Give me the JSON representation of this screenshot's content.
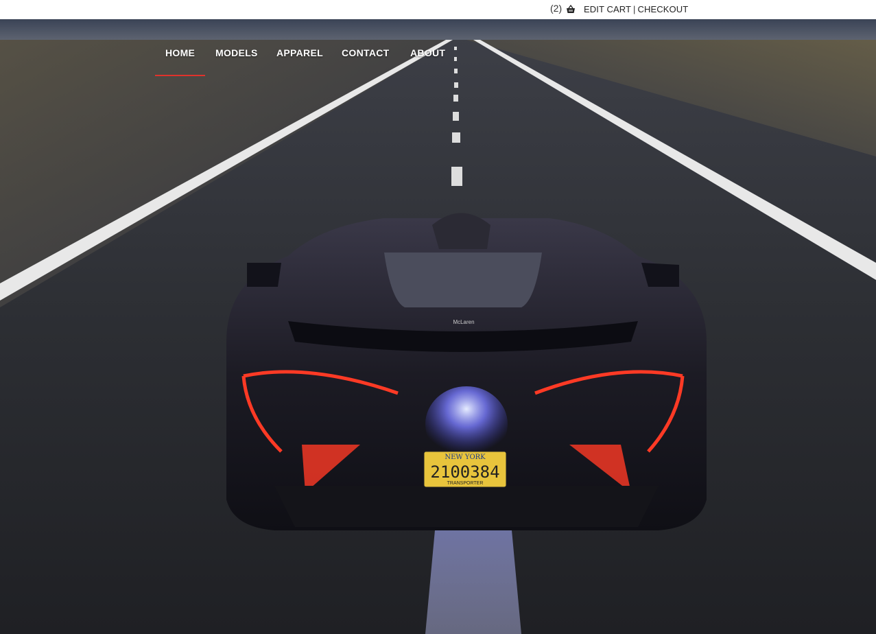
{
  "topbar": {
    "cart_count": "(2)",
    "edit_cart": "EDIT CART",
    "separator": "|",
    "checkout": "CHECKOUT"
  },
  "nav": {
    "items": [
      {
        "label": "HOME",
        "active": true
      },
      {
        "label": "MODELS"
      },
      {
        "label": "APPAREL"
      },
      {
        "label": "CONTACT"
      },
      {
        "label": "ABOUT"
      }
    ],
    "accent_color": "#e0322b"
  },
  "hero": {
    "plate_state": "NEW YORK",
    "plate_number": "2100384",
    "plate_sub": "TRANSPORTER",
    "badge_text": "McLaren"
  },
  "icons": {
    "cart": "basket-icon"
  }
}
